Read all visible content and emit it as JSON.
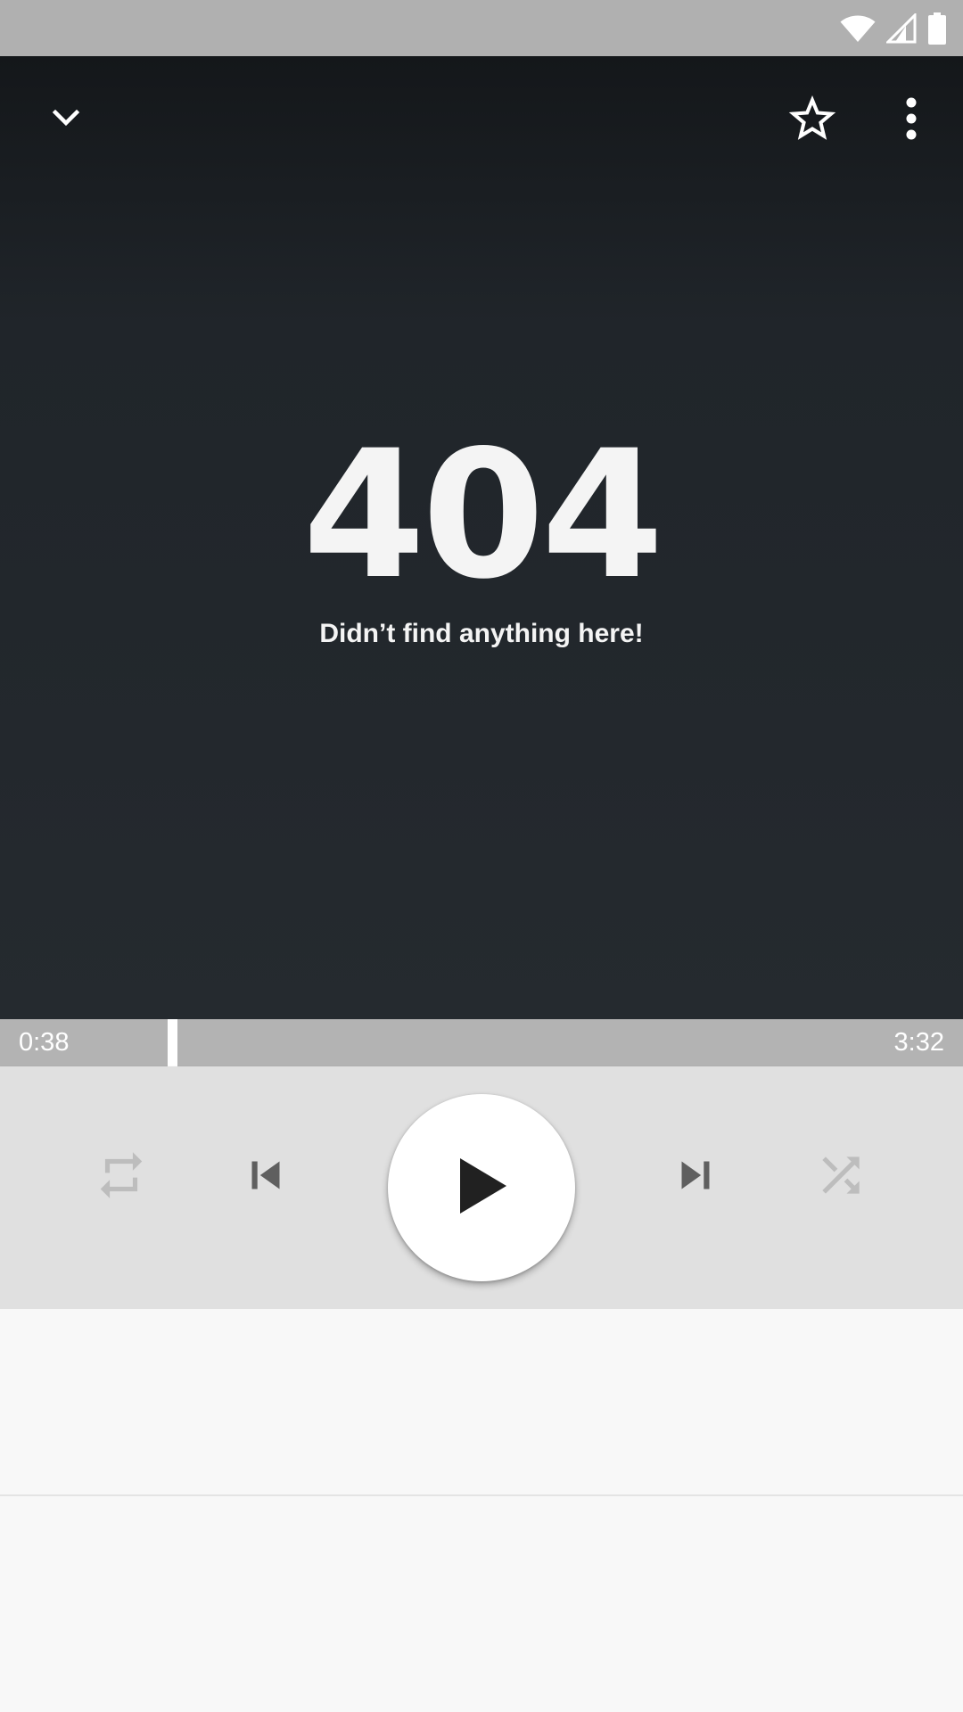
{
  "status_bar": {
    "icons": [
      "wifi-icon",
      "cell-signal-icon",
      "battery-icon"
    ],
    "color": "#b0b0b0"
  },
  "player": {
    "top_actions": [
      "chevron-down-icon",
      "star-outline-icon",
      "more-vert-icon"
    ],
    "artwork": {
      "code": "404",
      "message": "Didn’t find anything here!"
    },
    "seek": {
      "elapsed": "0:38",
      "total": "3:32",
      "progress_fraction": 0.179
    },
    "controls": [
      "repeat-icon",
      "skip-previous-icon",
      "play-icon",
      "skip-next-icon",
      "shuffle-icon"
    ],
    "state": "paused"
  },
  "colors": {
    "artwork_top": "#14171a",
    "artwork_bottom": "#252a2f",
    "seek_bar": "#b3b3b3",
    "controls_bg": "#e0e0e0",
    "play_button_bg": "#ffffff",
    "background": "#f8f8f8"
  }
}
